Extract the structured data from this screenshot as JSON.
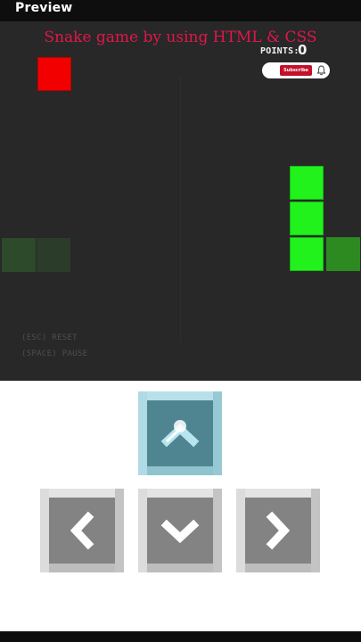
{
  "header": {
    "preview_label": "Preview"
  },
  "game": {
    "title": "Snake game by using HTML & CSS",
    "points_label": "POINTS:",
    "points_value": "0",
    "subscribe_label": "Subscribe",
    "hint_reset": "(ESC) RESET",
    "hint_pause": "(SPACE) PAUSE",
    "colors": {
      "board": "#282828",
      "food": "#f20000",
      "snake": "#21f21c",
      "title": "#e0174a"
    }
  },
  "controls": {
    "up": "arrow-up-icon",
    "left": "chevron-left-icon",
    "down": "chevron-down-icon",
    "right": "chevron-right-icon"
  }
}
